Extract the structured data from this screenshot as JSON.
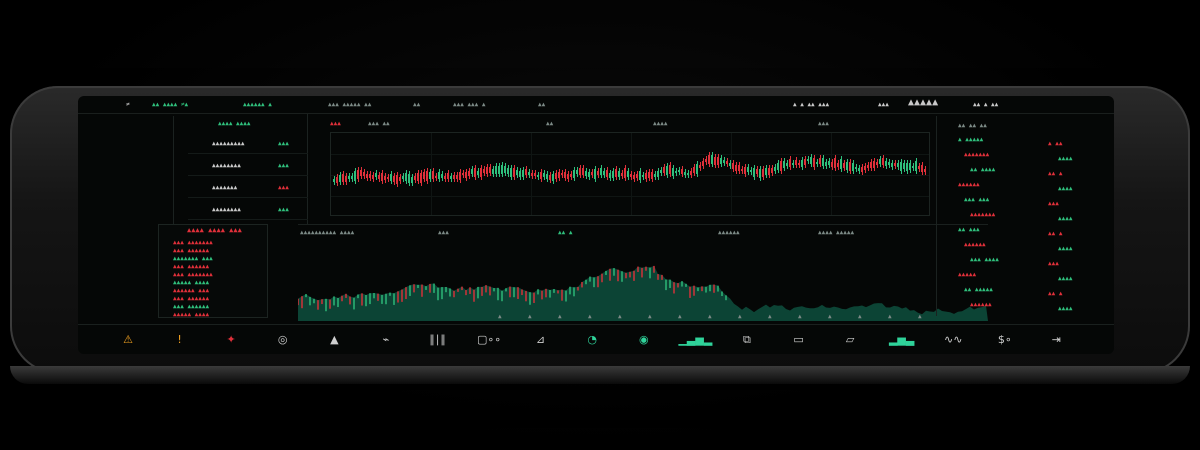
{
  "topbar": {
    "items": [
      "≠",
      "▲▲ ▲▲▲▲ ≠▲",
      "▲▲▲▲▲▲ ▲",
      "▲▲▲ ▲▲▲▲▲ ▲▲",
      "▲▲",
      "▲▲▲ ▲▲▲ ▲",
      "▲▲ ▲",
      "▲▲",
      "▲▲",
      "▲ ▲ ▲▲ ▲▲▲",
      "▲▲▲",
      "▲ ▲ ▲ ▲▲▲▲",
      "▲ ▲▲",
      "▲ ▲▲",
      "▲ ▲▲▲",
      "▲▲ ▲ ▲▲"
    ],
    "right_readout": "▲▲▲▲▲"
  },
  "left_panel": {
    "header": "▲▲▲▲ ▲▲▲▲",
    "rows": [
      {
        "label": "▲▲▲▲▲▲▲▲▲",
        "value": "▲▲▲"
      },
      {
        "label": "▲▲▲▲▲▲▲▲",
        "value": "▲▲▲"
      },
      {
        "label": "▲▲▲▲▲▲▲",
        "value": "▲▲▲"
      },
      {
        "label": "▲▲▲▲▲▲▲▲",
        "value": "▲▲▲"
      }
    ]
  },
  "main_chart": {
    "header_items": [
      "▲▲▲",
      "▲▲▲",
      "▲▲▲ ▲▲",
      "▲▲▲ ▲▲",
      "▲▲▲▲▲",
      "▲▲",
      "▲▲▲",
      "▲▲▲▲",
      "▲▲▲",
      "▲▲▲ ▲▲▲",
      "▲▲▲",
      "▲▲▲"
    ]
  },
  "order_book": {
    "title": "▲▲▲▲ ▲▲▲▲ ▲▲▲",
    "rows": [
      "▲▲▲ ▲▲▲▲▲▲▲",
      "▲▲▲ ▲▲▲▲▲▲",
      "▲▲▲▲▲▲▲ ▲▲▲",
      "▲▲▲ ▲▲▲▲▲▲",
      "▲▲▲ ▲▲▲▲▲▲▲",
      "▲▲▲▲▲ ▲▲▲▲",
      "▲▲▲▲▲▲ ▲▲▲",
      "▲▲▲ ▲▲▲▲▲▲",
      "▲▲▲ ▲▲▲▲▲▲",
      "▲▲▲▲▲ ▲▲▲▲"
    ]
  },
  "area_chart": {
    "header_items": [
      "▲▲▲▲▲▲▲▲▲▲ ▲▲▲▲",
      "▲▲▲",
      "▲▲▲",
      "▲▲▲▲",
      "▲▲ ▲",
      "▲▲",
      "▲▲▲▲▲▲",
      "▲▲▲▲ ▲▲▲▲▲",
      "▲▲ ▲▲▲"
    ],
    "x_ticks": [
      "▲",
      "▲",
      "▲",
      "▲",
      "▲",
      "▲",
      "▲",
      "▲",
      "▲",
      "▲",
      "▲",
      "▲",
      "▲",
      "▲",
      "▲"
    ]
  },
  "right_panel": {
    "header": "▲▲ ▲▲ ▲▲",
    "rows": [
      "▲ ▲▲▲▲▲",
      "▲▲▲▲▲▲▲",
      "▲▲ ▲▲▲▲",
      "▲▲▲▲▲▲",
      "▲▲▲ ▲▲▲",
      "▲▲▲▲▲▲▲",
      "▲▲ ▲▲▲",
      "▲▲▲▲▲▲",
      "▲▲▲ ▲▲▲▲",
      "▲▲▲▲▲",
      "▲▲ ▲▲▲▲▲",
      "▲▲▲▲▲▲"
    ]
  },
  "icon_bar": {
    "items": [
      {
        "name": "alert-icon",
        "glyph": "⚠"
      },
      {
        "name": "info-icon",
        "glyph": "!"
      },
      {
        "name": "flame-icon",
        "glyph": "✦"
      },
      {
        "name": "globe-icon",
        "glyph": "◎"
      },
      {
        "name": "triangle-icon",
        "glyph": "▲"
      },
      {
        "name": "trend-icon",
        "glyph": "⌁"
      },
      {
        "name": "bars-icon",
        "glyph": "∥∣∥"
      },
      {
        "name": "box-icon",
        "glyph": "▢∘∘"
      },
      {
        "name": "wave-icon",
        "glyph": "⊿"
      },
      {
        "name": "dial-icon",
        "glyph": "◔"
      },
      {
        "name": "refresh-icon",
        "glyph": "◉"
      },
      {
        "name": "area-icon",
        "glyph": "▁▃▅▂"
      },
      {
        "name": "layers-icon",
        "glyph": "⧉"
      },
      {
        "name": "square-icon",
        "glyph": "▭"
      },
      {
        "name": "panel-icon",
        "glyph": "▱"
      },
      {
        "name": "spark-icon",
        "glyph": "▂▅▃"
      },
      {
        "name": "pulse-icon",
        "glyph": "∿∿"
      },
      {
        "name": "dollar-icon",
        "glyph": "$∘"
      },
      {
        "name": "exit-icon",
        "glyph": "⇥"
      }
    ]
  },
  "colors": {
    "up": "#2fbf7c",
    "down": "#e0303a",
    "text": "#c9c9c9"
  }
}
